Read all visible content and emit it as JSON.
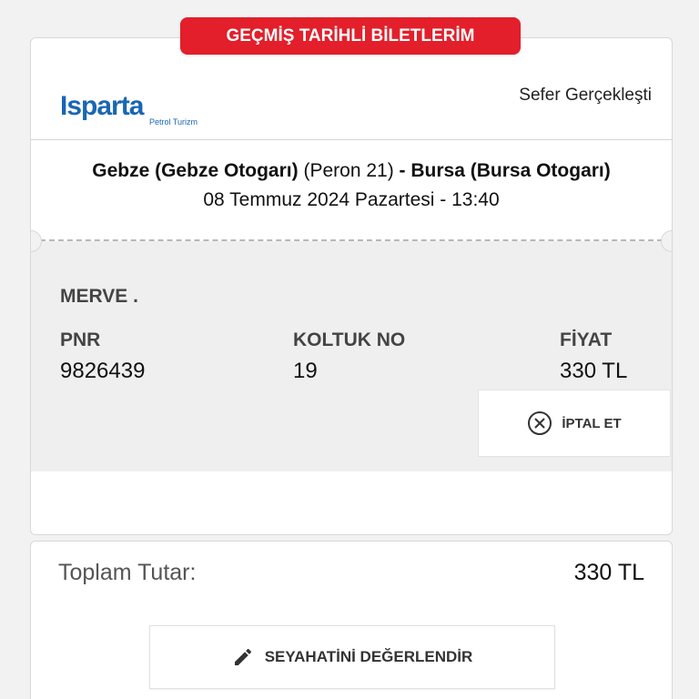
{
  "banner": {
    "title": "GEÇMİŞ TARİHLİ BİLETLERİM"
  },
  "ticket": {
    "company_logo": {
      "text_main": "Isparta",
      "text_sub": "Petrol Turizm"
    },
    "status": "Sefer Gerçekleşti",
    "route": {
      "origin": "Gebze (Gebze Otogarı)",
      "platform": "(Peron 21)",
      "separator": "-",
      "destination": "Bursa (Bursa Otogarı)"
    },
    "datetime": "08 Temmuz 2024 Pazartesi - 13:40",
    "passenger_name": "MERVE .",
    "pnr": {
      "label": "PNR",
      "value": "9826439"
    },
    "seat": {
      "label": "KOLTUK NO",
      "value": "19"
    },
    "price": {
      "label": "FİYAT",
      "value": "330 TL"
    },
    "cancel_button": {
      "label": "İPTAL ET",
      "icon": "close-circle-icon"
    }
  },
  "summary": {
    "total_label": "Toplam Tutar:",
    "total_value": "330 TL",
    "rate_button": {
      "label": "SEYAHATİNİ DEĞERLENDİR",
      "icon": "pencil-icon"
    }
  },
  "colors": {
    "brand_red": "#e21f2a",
    "logo_blue": "#1a66b3"
  }
}
